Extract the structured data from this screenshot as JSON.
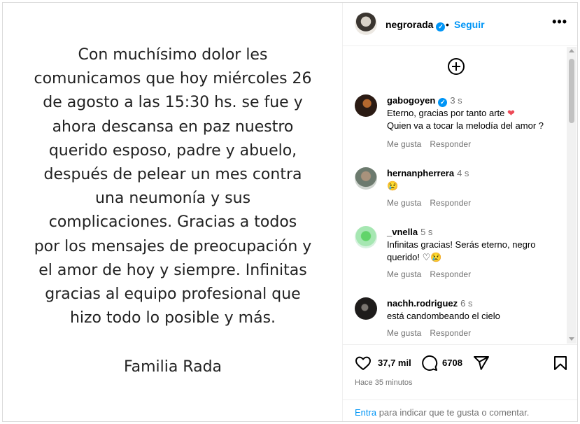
{
  "post": {
    "lines": [
      "Con muchísimo dolor les",
      "comunicamos que hoy miércoles 26",
      "de agosto a las 15:30 hs. se fue y",
      "ahora descansa en paz nuestro",
      "querido esposo, padre y abuelo,",
      "después de pelear un mes contra",
      "una neumonía y sus",
      "complicaciones. Gracias a todos",
      "por los mensajes de preocupación y",
      "el amor de hoy y siempre. Infinitas",
      "gracias al equipo profesional que",
      "hizo todo lo posible y más."
    ],
    "signature": "Familia Rada"
  },
  "header": {
    "username": "negrorada",
    "verified_mark": "✓",
    "dot": "•",
    "follow_label": "Seguir",
    "more_label": "•••"
  },
  "comments": [
    {
      "user": "gabogoyen",
      "verified": true,
      "time": "3 s",
      "line1": "Eterno, gracias por tanto arte",
      "emoji1": "❤",
      "line2": "Quien va a tocar la melodía del amor ?",
      "like": "Me gusta",
      "reply": "Responder"
    },
    {
      "user": "hernanpherrera",
      "time": "4 s",
      "line1": "😢",
      "like": "Me gusta",
      "reply": "Responder"
    },
    {
      "user": "_vnella",
      "time": "5 s",
      "line1": "Infinitas gracias! Serás eterno, negro",
      "line2": "querido! ♡😢",
      "like": "Me gusta",
      "reply": "Responder"
    },
    {
      "user": "nachh.rodriguez",
      "time": "6 s",
      "line1": "está candombeando el cielo",
      "like": "Me gusta",
      "reply": "Responder"
    }
  ],
  "footer": {
    "likes_count": "37,7 mil",
    "comments_count": "6708",
    "time_ago": "Hace 35 minutos",
    "login_link": "Entra",
    "login_text": " para indicar que te gusta o comentar."
  },
  "colors": {
    "accent": "#0095f6",
    "heart": "#ed4956",
    "muted": "#737373"
  },
  "icons": [
    "add-comment-icon",
    "heart-icon",
    "comment-icon",
    "share-icon",
    "bookmark-icon",
    "more-icon",
    "verified-icon"
  ]
}
